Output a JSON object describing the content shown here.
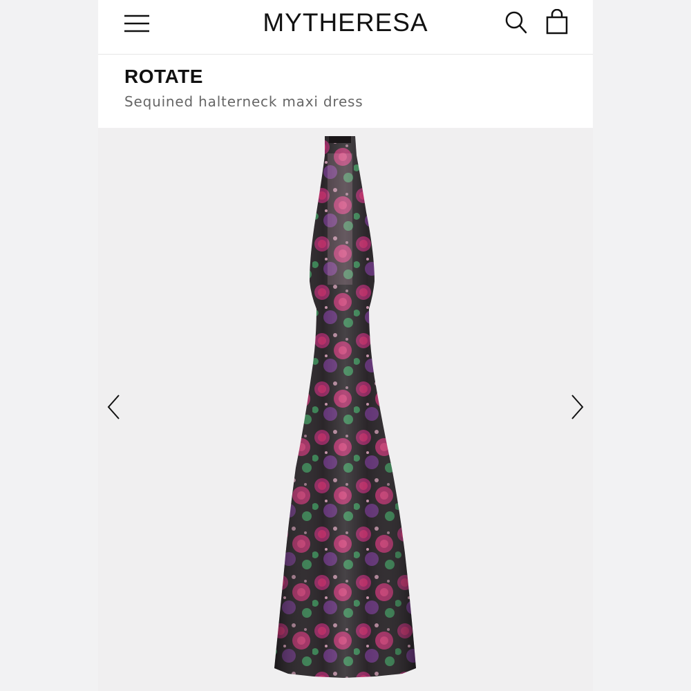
{
  "header": {
    "logo": "MYTHERESA",
    "menu_icon": "hamburger-menu-icon",
    "search_icon": "search-icon",
    "bag_icon": "shopping-bag-icon"
  },
  "product": {
    "brand": "ROTATE",
    "name": "Sequined halterneck maxi dress"
  },
  "gallery": {
    "prev_icon": "chevron-left-icon",
    "next_icon": "chevron-right-icon",
    "image_colors": {
      "base": "#1f1a1e",
      "rose": "#b3245f",
      "magenta": "#8a1f58",
      "purple": "#5a2a6e",
      "leaf": "#2f7a4a",
      "sequin_highlight": "#e8a9c4"
    }
  }
}
